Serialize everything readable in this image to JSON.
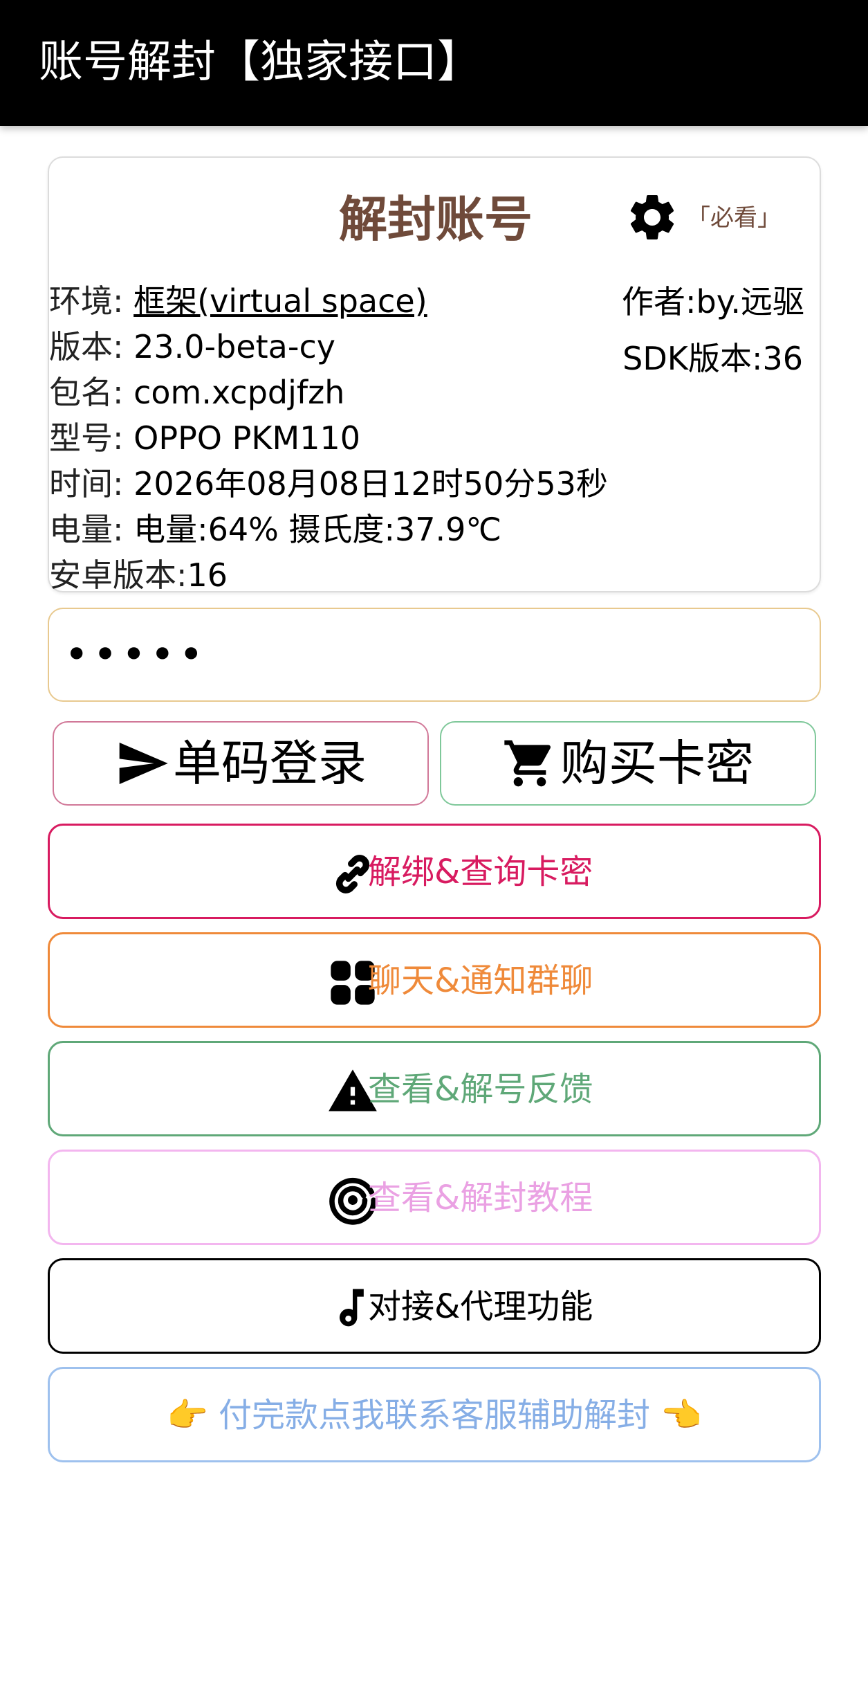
{
  "header": {
    "title": "账号解封【独家接口】"
  },
  "info_card": {
    "title": "解封账号",
    "gear_icon": "gear-icon",
    "must_read": "「必看」",
    "author": "作者:by.远驱",
    "sdk": "SDK版本:36",
    "rows": [
      {
        "label": "环境: ",
        "value": "框架(virtual space)"
      },
      {
        "label": "版本: ",
        "value": "23.0-beta-cy"
      },
      {
        "label": "包名: ",
        "value": "com.xcpdjfzh"
      },
      {
        "label": "型号: ",
        "value": "OPPO PKM110"
      },
      {
        "label": "时间: ",
        "value": "2026年08月08日12时50分53秒"
      },
      {
        "label": "电量: ",
        "value": "电量:64%  摄氏度:37.9℃"
      },
      {
        "label": "安卓版本:",
        "value": "16"
      }
    ]
  },
  "code_input": {
    "value": "•••••"
  },
  "buttons": {
    "login": {
      "label": "单码登录",
      "icon": "send-icon"
    },
    "buy": {
      "label": "购买卡密",
      "icon": "cart-icon"
    },
    "unbind": {
      "label": "解绑&查询卡密",
      "icon": "link-icon",
      "color": "#d81b60"
    },
    "chat": {
      "label": "聊天&通知群聊",
      "icon": "apps-grid-icon",
      "color": "#ef8a3a"
    },
    "feedback": {
      "label": "查看&解号反馈",
      "icon": "warning-icon",
      "color": "#5fa878"
    },
    "tutorial": {
      "label": "查看&解封教程",
      "icon": "radar-icon",
      "color": "#eaa1e3"
    },
    "agent": {
      "label": "对接&代理功能",
      "icon": "music-note-icon",
      "color": "#000000"
    },
    "contact": {
      "label": "👉 付完款点我联系客服辅助解封 👈",
      "color": "#86aee6"
    }
  }
}
